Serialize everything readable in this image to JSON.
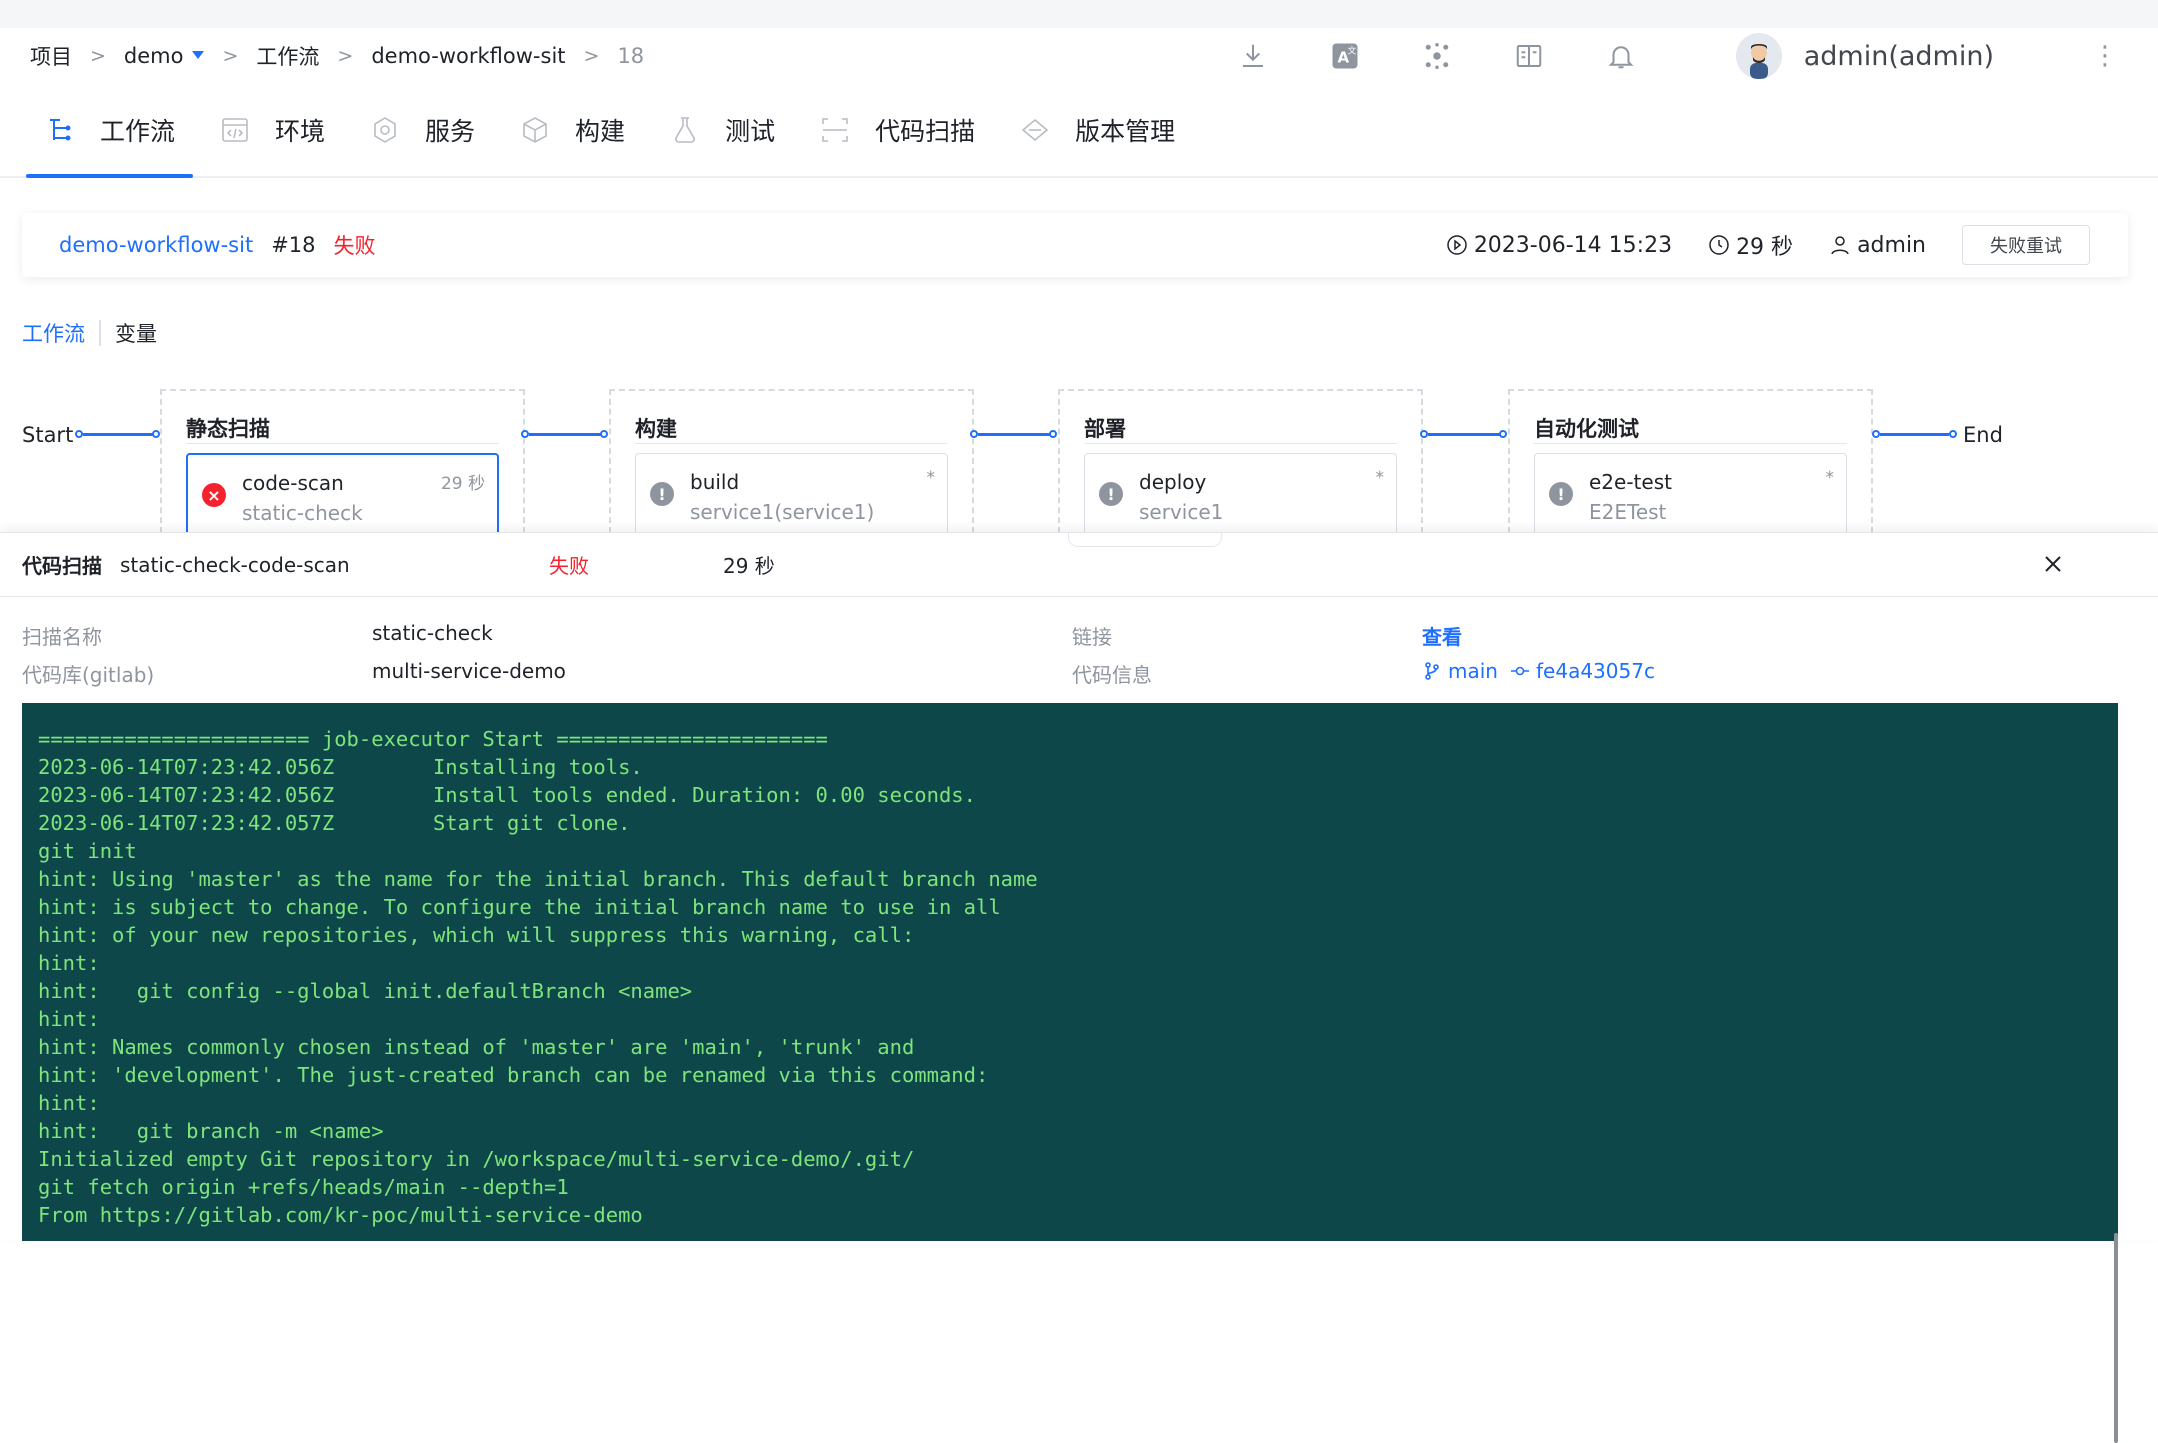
{
  "breadcrumb": {
    "items": [
      "项目",
      "demo",
      "工作流",
      "demo-workflow-sit"
    ],
    "current": "18",
    "separator": ">"
  },
  "header": {
    "icons": [
      "download-icon",
      "translate-icon",
      "plugin-icon",
      "docs-icon",
      "bell-icon"
    ],
    "user": "admin(admin)",
    "more": "⋮"
  },
  "module_tabs": [
    {
      "label": "工作流",
      "icon": "workflow-icon",
      "active": true
    },
    {
      "label": "环境",
      "icon": "environment-icon"
    },
    {
      "label": "服务",
      "icon": "service-icon"
    },
    {
      "label": "构建",
      "icon": "build-icon"
    },
    {
      "label": "测试",
      "icon": "test-icon"
    },
    {
      "label": "代码扫描",
      "icon": "scan-icon"
    },
    {
      "label": "版本管理",
      "icon": "version-icon"
    }
  ],
  "summary": {
    "workflow": "demo-workflow-sit",
    "run": "#18",
    "status": "失败",
    "start_time": "2023-06-14 15:23",
    "duration": "29 秒",
    "creator": "admin",
    "retry_label": "失败重试"
  },
  "sub_tabs": {
    "workflow": "工作流",
    "variables": "变量"
  },
  "pipeline": {
    "start": "Start",
    "end": "End",
    "stages": [
      {
        "title": "静态扫描",
        "job": {
          "name": "code-scan",
          "sub": "static-check",
          "right": "29 秒",
          "status": "failed"
        }
      },
      {
        "title": "构建",
        "job": {
          "name": "build",
          "sub": "service1(service1)",
          "right": "*",
          "status": "pending"
        }
      },
      {
        "title": "部署",
        "job": {
          "name": "deploy",
          "sub": "service1",
          "right": "*",
          "status": "pending"
        }
      },
      {
        "title": "自动化测试",
        "job": {
          "name": "e2e-test",
          "sub": "E2ETest",
          "right": "*",
          "status": "pending"
        }
      }
    ]
  },
  "panel": {
    "title": "代码扫描",
    "name": "static-check-code-scan",
    "status": "失败",
    "duration": "29 秒",
    "fields": {
      "scan_name_label": "扫描名称",
      "scan_name": "static-check",
      "repo_label": "代码库(gitlab)",
      "repo": "multi-service-demo",
      "link_label": "链接",
      "link": "查看",
      "code_label": "代码信息",
      "branch": "main",
      "commit": "fe4a43057c"
    },
    "log": [
      "====================== job-executor Start ======================",
      "2023-06-14T07:23:42.056Z        Installing tools.",
      "2023-06-14T07:23:42.056Z        Install tools ended. Duration: 0.00 seconds.",
      "2023-06-14T07:23:42.057Z        Start git clone.",
      "git init",
      "hint: Using 'master' as the name for the initial branch. This default branch name",
      "hint: is subject to change. To configure the initial branch name to use in all",
      "hint: of your new repositories, which will suppress this warning, call:",
      "hint:",
      "hint:   git config --global init.defaultBranch <name>",
      "hint:",
      "hint: Names commonly chosen instead of 'master' are 'main', 'trunk' and",
      "hint: 'development'. The just-created branch can be renamed via this command:",
      "hint:",
      "hint:   git branch -m <name>",
      "Initialized empty Git repository in /workspace/multi-service-demo/.git/",
      "git fetch origin +refs/heads/main --depth=1",
      "From https://gitlab.com/kr-poc/multi-service-demo"
    ]
  },
  "colors": {
    "accent": "#1f6fff",
    "failed": "#f5222d",
    "log_bg": "#0d4749",
    "log_text": "#7fe57a"
  }
}
